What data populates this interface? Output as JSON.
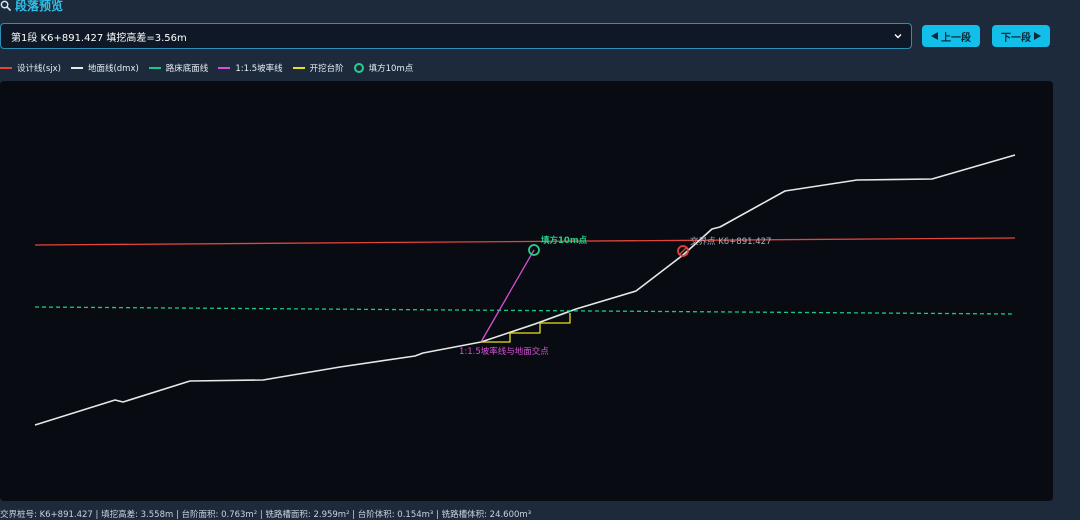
{
  "header": {
    "title": "段落预览",
    "title_icon": "search-icon",
    "accent_color": "#2fc0ea"
  },
  "segment_select": {
    "selected": "第1段 K6+891.427 填挖高差=3.56m"
  },
  "buttons": {
    "prev_label": "上一段",
    "next_label": "下一段"
  },
  "legend": {
    "items": [
      {
        "label": "设计线(sjx)",
        "color": "#e0463c",
        "kind": "line"
      },
      {
        "label": "地面线(dmx)",
        "color": "#e8e8e8",
        "kind": "line"
      },
      {
        "label": "路床底面线",
        "color": "#17c98a",
        "kind": "line"
      },
      {
        "label": "1:1.5坡率线",
        "color": "#d84fd6",
        "kind": "line"
      },
      {
        "label": "开挖台阶",
        "color": "#e8e01c",
        "kind": "line"
      },
      {
        "label": "填方10m点",
        "color": "#26d08c",
        "kind": "circle"
      }
    ]
  },
  "chart_data": {
    "type": "line",
    "title": "",
    "xlabel": "",
    "ylabel": "",
    "grid": false,
    "legend_position": "top-left",
    "series": [
      {
        "name": "设计线(sjx)",
        "color": "#e0463c",
        "style": "solid",
        "points": [
          [
            0,
            -180
          ],
          [
            980,
            -187
          ]
        ]
      },
      {
        "name": "地面线(dmx)",
        "color": "#e8e8e8",
        "style": "solid",
        "points": [
          [
            0,
            0
          ],
          [
            80,
            -25
          ],
          [
            88,
            -23
          ],
          [
            155,
            -44
          ],
          [
            228,
            -45
          ],
          [
            305,
            -58
          ],
          [
            380,
            -69
          ],
          [
            388,
            -72
          ],
          [
            446,
            -83
          ],
          [
            500,
            -101
          ],
          [
            541,
            -116
          ],
          [
            601,
            -134
          ],
          [
            648,
            -170
          ],
          [
            677,
            -196
          ],
          [
            685,
            -198
          ],
          [
            750,
            -234
          ],
          [
            822,
            -245
          ],
          [
            897,
            -246
          ],
          [
            980,
            -270
          ]
        ]
      },
      {
        "name": "路床底面线",
        "color": "#17c98a",
        "style": "dashed",
        "points": [
          [
            0,
            -118
          ],
          [
            980,
            -111
          ]
        ]
      },
      {
        "name": "1:1.5坡率线",
        "color": "#d84fd6",
        "style": "solid",
        "points": [
          [
            446,
            -83
          ],
          [
            499,
            -175
          ]
        ]
      },
      {
        "name": "开挖台阶",
        "color": "#e8e01c",
        "style": "solid",
        "points": [
          [
            446,
            -83
          ],
          [
            475,
            -83
          ],
          [
            475,
            -92
          ],
          [
            505,
            -92
          ],
          [
            505,
            -102
          ],
          [
            535,
            -102
          ],
          [
            535,
            -112
          ]
        ]
      }
    ],
    "markers": [
      {
        "label": "填方10m点",
        "x": 499,
        "y": -175,
        "color": "#26d08c"
      },
      {
        "label": "交界点 K6+891.427",
        "x": 648,
        "y": -174,
        "color": "#e0463c"
      }
    ],
    "annotations": [
      {
        "text": "1:1.5坡率线与地面交点",
        "x": 446,
        "y": -83,
        "color": "#d84fd6"
      }
    ],
    "fill_region": {
      "color": "#17c98a",
      "points": [
        [
          446,
          -83
        ],
        [
          535,
          -112
        ],
        [
          535,
          -115
        ],
        [
          446,
          -83
        ]
      ]
    }
  },
  "footer": {
    "text": "交界桩号: K6+891.427 | 填挖高差: 3.558m | 台阶面积: 0.763m² | 铣路槽面积: 2.959m² | 台阶体积: 0.154m³ | 铣路槽体积: 24.600m³"
  }
}
